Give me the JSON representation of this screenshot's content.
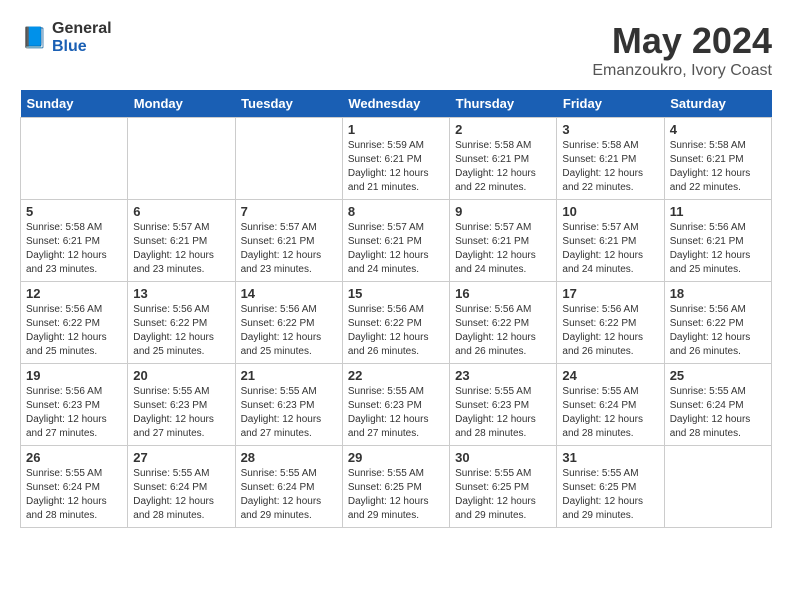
{
  "logo": {
    "general": "General",
    "blue": "Blue"
  },
  "title": "May 2024",
  "subtitle": "Emanzoukro, Ivory Coast",
  "headers": [
    "Sunday",
    "Monday",
    "Tuesday",
    "Wednesday",
    "Thursday",
    "Friday",
    "Saturday"
  ],
  "weeks": [
    [
      {
        "day": "",
        "info": ""
      },
      {
        "day": "",
        "info": ""
      },
      {
        "day": "",
        "info": ""
      },
      {
        "day": "1",
        "info": "Sunrise: 5:59 AM\nSunset: 6:21 PM\nDaylight: 12 hours and 21 minutes."
      },
      {
        "day": "2",
        "info": "Sunrise: 5:58 AM\nSunset: 6:21 PM\nDaylight: 12 hours and 22 minutes."
      },
      {
        "day": "3",
        "info": "Sunrise: 5:58 AM\nSunset: 6:21 PM\nDaylight: 12 hours and 22 minutes."
      },
      {
        "day": "4",
        "info": "Sunrise: 5:58 AM\nSunset: 6:21 PM\nDaylight: 12 hours and 22 minutes."
      }
    ],
    [
      {
        "day": "5",
        "info": "Sunrise: 5:58 AM\nSunset: 6:21 PM\nDaylight: 12 hours and 23 minutes."
      },
      {
        "day": "6",
        "info": "Sunrise: 5:57 AM\nSunset: 6:21 PM\nDaylight: 12 hours and 23 minutes."
      },
      {
        "day": "7",
        "info": "Sunrise: 5:57 AM\nSunset: 6:21 PM\nDaylight: 12 hours and 23 minutes."
      },
      {
        "day": "8",
        "info": "Sunrise: 5:57 AM\nSunset: 6:21 PM\nDaylight: 12 hours and 24 minutes."
      },
      {
        "day": "9",
        "info": "Sunrise: 5:57 AM\nSunset: 6:21 PM\nDaylight: 12 hours and 24 minutes."
      },
      {
        "day": "10",
        "info": "Sunrise: 5:57 AM\nSunset: 6:21 PM\nDaylight: 12 hours and 24 minutes."
      },
      {
        "day": "11",
        "info": "Sunrise: 5:56 AM\nSunset: 6:21 PM\nDaylight: 12 hours and 25 minutes."
      }
    ],
    [
      {
        "day": "12",
        "info": "Sunrise: 5:56 AM\nSunset: 6:22 PM\nDaylight: 12 hours and 25 minutes."
      },
      {
        "day": "13",
        "info": "Sunrise: 5:56 AM\nSunset: 6:22 PM\nDaylight: 12 hours and 25 minutes."
      },
      {
        "day": "14",
        "info": "Sunrise: 5:56 AM\nSunset: 6:22 PM\nDaylight: 12 hours and 25 minutes."
      },
      {
        "day": "15",
        "info": "Sunrise: 5:56 AM\nSunset: 6:22 PM\nDaylight: 12 hours and 26 minutes."
      },
      {
        "day": "16",
        "info": "Sunrise: 5:56 AM\nSunset: 6:22 PM\nDaylight: 12 hours and 26 minutes."
      },
      {
        "day": "17",
        "info": "Sunrise: 5:56 AM\nSunset: 6:22 PM\nDaylight: 12 hours and 26 minutes."
      },
      {
        "day": "18",
        "info": "Sunrise: 5:56 AM\nSunset: 6:22 PM\nDaylight: 12 hours and 26 minutes."
      }
    ],
    [
      {
        "day": "19",
        "info": "Sunrise: 5:56 AM\nSunset: 6:23 PM\nDaylight: 12 hours and 27 minutes."
      },
      {
        "day": "20",
        "info": "Sunrise: 5:55 AM\nSunset: 6:23 PM\nDaylight: 12 hours and 27 minutes."
      },
      {
        "day": "21",
        "info": "Sunrise: 5:55 AM\nSunset: 6:23 PM\nDaylight: 12 hours and 27 minutes."
      },
      {
        "day": "22",
        "info": "Sunrise: 5:55 AM\nSunset: 6:23 PM\nDaylight: 12 hours and 27 minutes."
      },
      {
        "day": "23",
        "info": "Sunrise: 5:55 AM\nSunset: 6:23 PM\nDaylight: 12 hours and 28 minutes."
      },
      {
        "day": "24",
        "info": "Sunrise: 5:55 AM\nSunset: 6:24 PM\nDaylight: 12 hours and 28 minutes."
      },
      {
        "day": "25",
        "info": "Sunrise: 5:55 AM\nSunset: 6:24 PM\nDaylight: 12 hours and 28 minutes."
      }
    ],
    [
      {
        "day": "26",
        "info": "Sunrise: 5:55 AM\nSunset: 6:24 PM\nDaylight: 12 hours and 28 minutes."
      },
      {
        "day": "27",
        "info": "Sunrise: 5:55 AM\nSunset: 6:24 PM\nDaylight: 12 hours and 28 minutes."
      },
      {
        "day": "28",
        "info": "Sunrise: 5:55 AM\nSunset: 6:24 PM\nDaylight: 12 hours and 29 minutes."
      },
      {
        "day": "29",
        "info": "Sunrise: 5:55 AM\nSunset: 6:25 PM\nDaylight: 12 hours and 29 minutes."
      },
      {
        "day": "30",
        "info": "Sunrise: 5:55 AM\nSunset: 6:25 PM\nDaylight: 12 hours and 29 minutes."
      },
      {
        "day": "31",
        "info": "Sunrise: 5:55 AM\nSunset: 6:25 PM\nDaylight: 12 hours and 29 minutes."
      },
      {
        "day": "",
        "info": ""
      }
    ]
  ]
}
